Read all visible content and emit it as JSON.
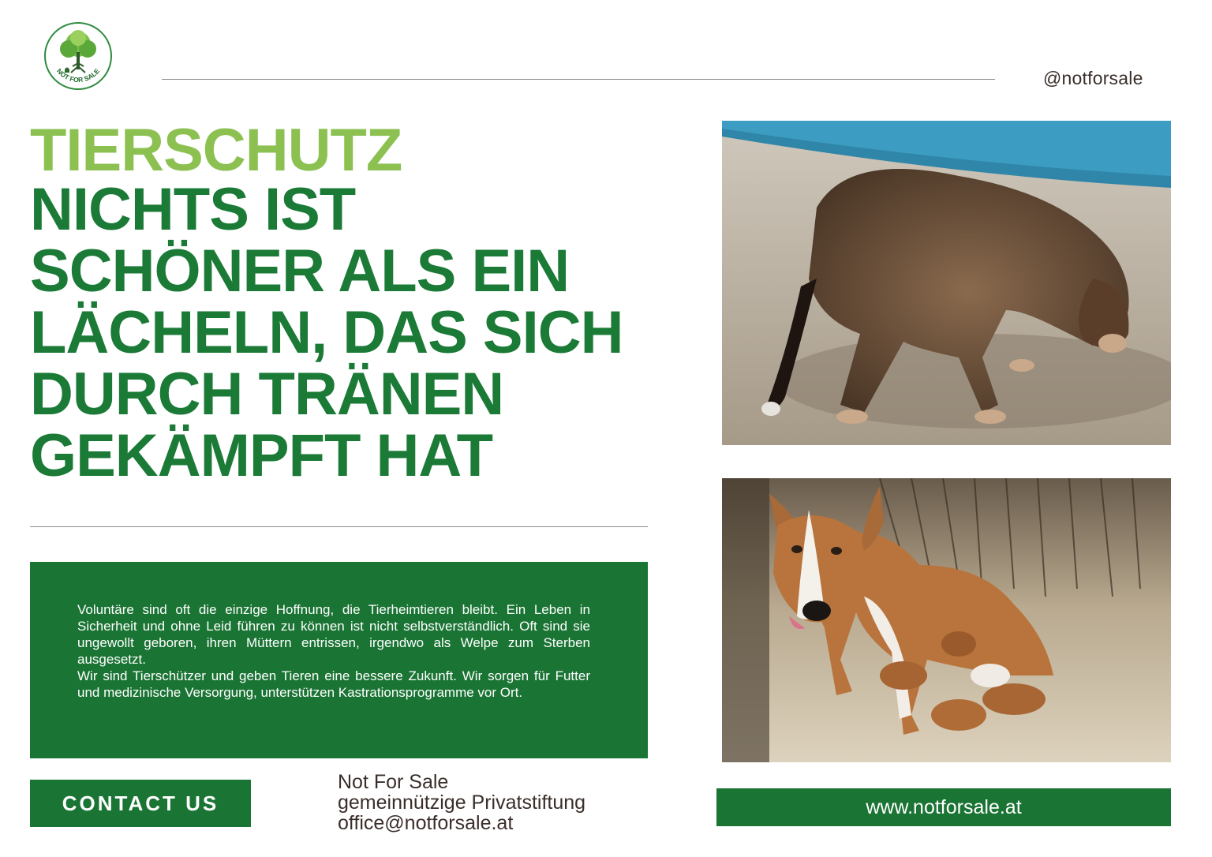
{
  "logo": {
    "text": "NOT FOR SALE",
    "icon": "tree-icon"
  },
  "header": {
    "handle": "@notforsale"
  },
  "headline": {
    "kicker": "TIERSCHUTZ",
    "lines": [
      "NICHTS IST",
      "SCHÖNER ALS EIN",
      "LÄCHELN, DAS SICH",
      "DURCH TRÄNEN",
      "GEKÄMPFT HAT"
    ]
  },
  "body": {
    "paragraph_1": "Voluntäre sind oft die einzige Hoffnung, die Tierheimtieren bleibt. Ein Leben in Sicherheit und ohne Leid führen zu können ist nicht selbstverständlich. Oft sind sie ungewollt geboren, ihren Müttern entrissen, irgendwo als Welpe zum Sterben ausgesetzt.",
    "paragraph_2": "Wir sind Tierschützer und geben Tieren eine bessere Zukunft. Wir sorgen für Futter und medizinische Versorgung, unterstützen Kastrationsprogramme vor Ort."
  },
  "contact": {
    "label": "CONTACT US"
  },
  "address": {
    "line_1": "Not For Sale",
    "line_2": "gemeinnützige Privatstiftung",
    "line_3": "office@notforsale.at"
  },
  "website": {
    "label": "www.notforsale.at"
  },
  "colors": {
    "green_dark": "#1a7434",
    "green_light": "#8cc152",
    "text_brown": "#3a2e2a"
  }
}
